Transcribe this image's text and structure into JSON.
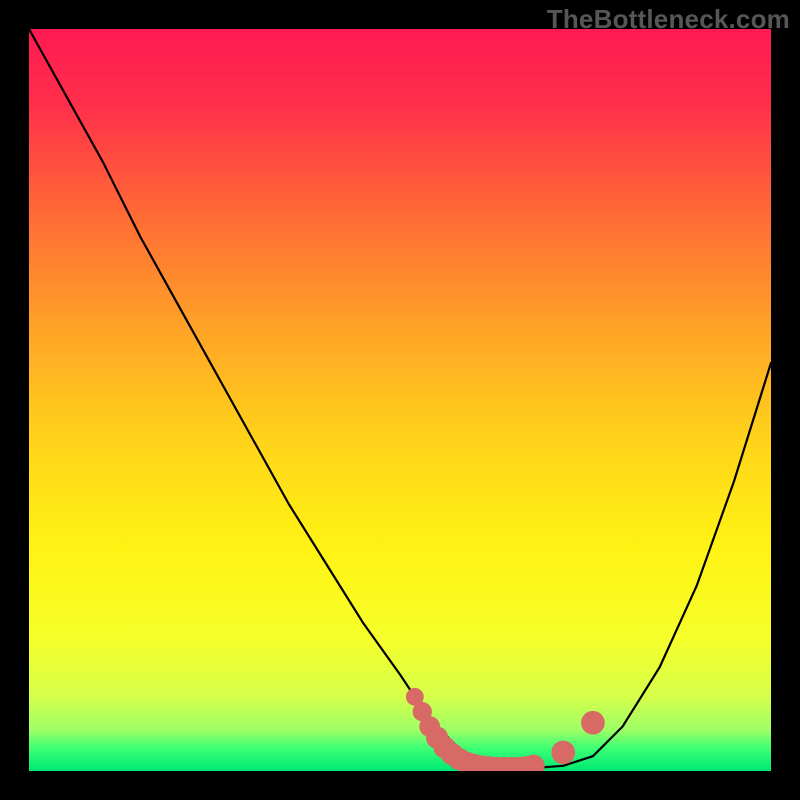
{
  "watermark": "TheBottleneck.com",
  "gradient_stops": [
    {
      "offset": 0.0,
      "color": "#ff1a52"
    },
    {
      "offset": 0.1,
      "color": "#ff2e4b"
    },
    {
      "offset": 0.25,
      "color": "#ff6a35"
    },
    {
      "offset": 0.4,
      "color": "#ffa227"
    },
    {
      "offset": 0.55,
      "color": "#ffd21a"
    },
    {
      "offset": 0.7,
      "color": "#fff314"
    },
    {
      "offset": 0.82,
      "color": "#f6ff2a"
    },
    {
      "offset": 0.9,
      "color": "#d6ff4a"
    },
    {
      "offset": 0.945,
      "color": "#9dff66"
    },
    {
      "offset": 0.97,
      "color": "#3aff74"
    },
    {
      "offset": 1.0,
      "color": "#00e874"
    }
  ],
  "chart_data": {
    "type": "line",
    "title": "",
    "xlabel": "",
    "ylabel": "",
    "xlim": [
      0,
      100
    ],
    "ylim": [
      0,
      100
    ],
    "series": [
      {
        "name": "bottleneck-curve",
        "x": [
          0,
          5,
          10,
          15,
          20,
          25,
          30,
          35,
          40,
          45,
          50,
          52,
          55,
          58,
          60,
          63,
          65,
          68,
          72,
          76,
          80,
          85,
          90,
          95,
          100
        ],
        "y": [
          100,
          91,
          82,
          72,
          63,
          54,
          45,
          36,
          28,
          20,
          13,
          10,
          6,
          3,
          1.5,
          0.6,
          0.4,
          0.4,
          0.7,
          2,
          6,
          14,
          25,
          39,
          55
        ]
      }
    ],
    "markers": {
      "name": "valley-markers",
      "color": "#d86a66",
      "points": [
        {
          "x": 52,
          "y": 10,
          "r": 1.2
        },
        {
          "x": 53,
          "y": 8,
          "r": 1.3
        },
        {
          "x": 54,
          "y": 6,
          "r": 1.4
        },
        {
          "x": 55,
          "y": 4.5,
          "r": 1.5
        },
        {
          "x": 56,
          "y": 3.2,
          "r": 1.5
        },
        {
          "x": 57,
          "y": 2.3,
          "r": 1.5
        },
        {
          "x": 58,
          "y": 1.6,
          "r": 1.5
        },
        {
          "x": 59,
          "y": 1.1,
          "r": 1.5
        },
        {
          "x": 60,
          "y": 0.8,
          "r": 1.5
        },
        {
          "x": 61,
          "y": 0.6,
          "r": 1.5
        },
        {
          "x": 62,
          "y": 0.5,
          "r": 1.5
        },
        {
          "x": 63,
          "y": 0.4,
          "r": 1.5
        },
        {
          "x": 64,
          "y": 0.4,
          "r": 1.5
        },
        {
          "x": 65,
          "y": 0.4,
          "r": 1.5
        },
        {
          "x": 66,
          "y": 0.4,
          "r": 1.5
        },
        {
          "x": 67,
          "y": 0.5,
          "r": 1.5
        },
        {
          "x": 68,
          "y": 0.7,
          "r": 1.5
        },
        {
          "x": 72,
          "y": 2.5,
          "r": 1.6
        },
        {
          "x": 76,
          "y": 6.5,
          "r": 1.6
        }
      ]
    }
  }
}
